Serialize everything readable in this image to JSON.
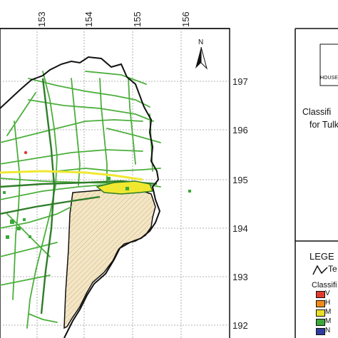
{
  "map": {
    "x_ticks": [
      "153",
      "154",
      "155",
      "156"
    ],
    "y_ticks": [
      "197",
      "196",
      "195",
      "194",
      "193",
      "192"
    ],
    "north_label": "N"
  },
  "legend_panel": {
    "house_label": "HOUSE",
    "title_line1": "Classifi",
    "title_line2": "for Tulk",
    "legend_header": "LEGE",
    "route_label": "Te",
    "classification_label": "Classifi",
    "swatches": [
      {
        "label": "V",
        "color": "#e03a2e"
      },
      {
        "label": "H",
        "color": "#f08a1a"
      },
      {
        "label": "M",
        "color": "#e8e028"
      },
      {
        "label": "M",
        "color": "#3ca83a"
      },
      {
        "label": "N",
        "color": "#2e3c9c"
      }
    ]
  },
  "colors": {
    "road_green": "#4caf3c",
    "highlight_yellow": "#f0e830",
    "hatched_fill": "#f4e6c4",
    "boundary_black": "#111111"
  }
}
